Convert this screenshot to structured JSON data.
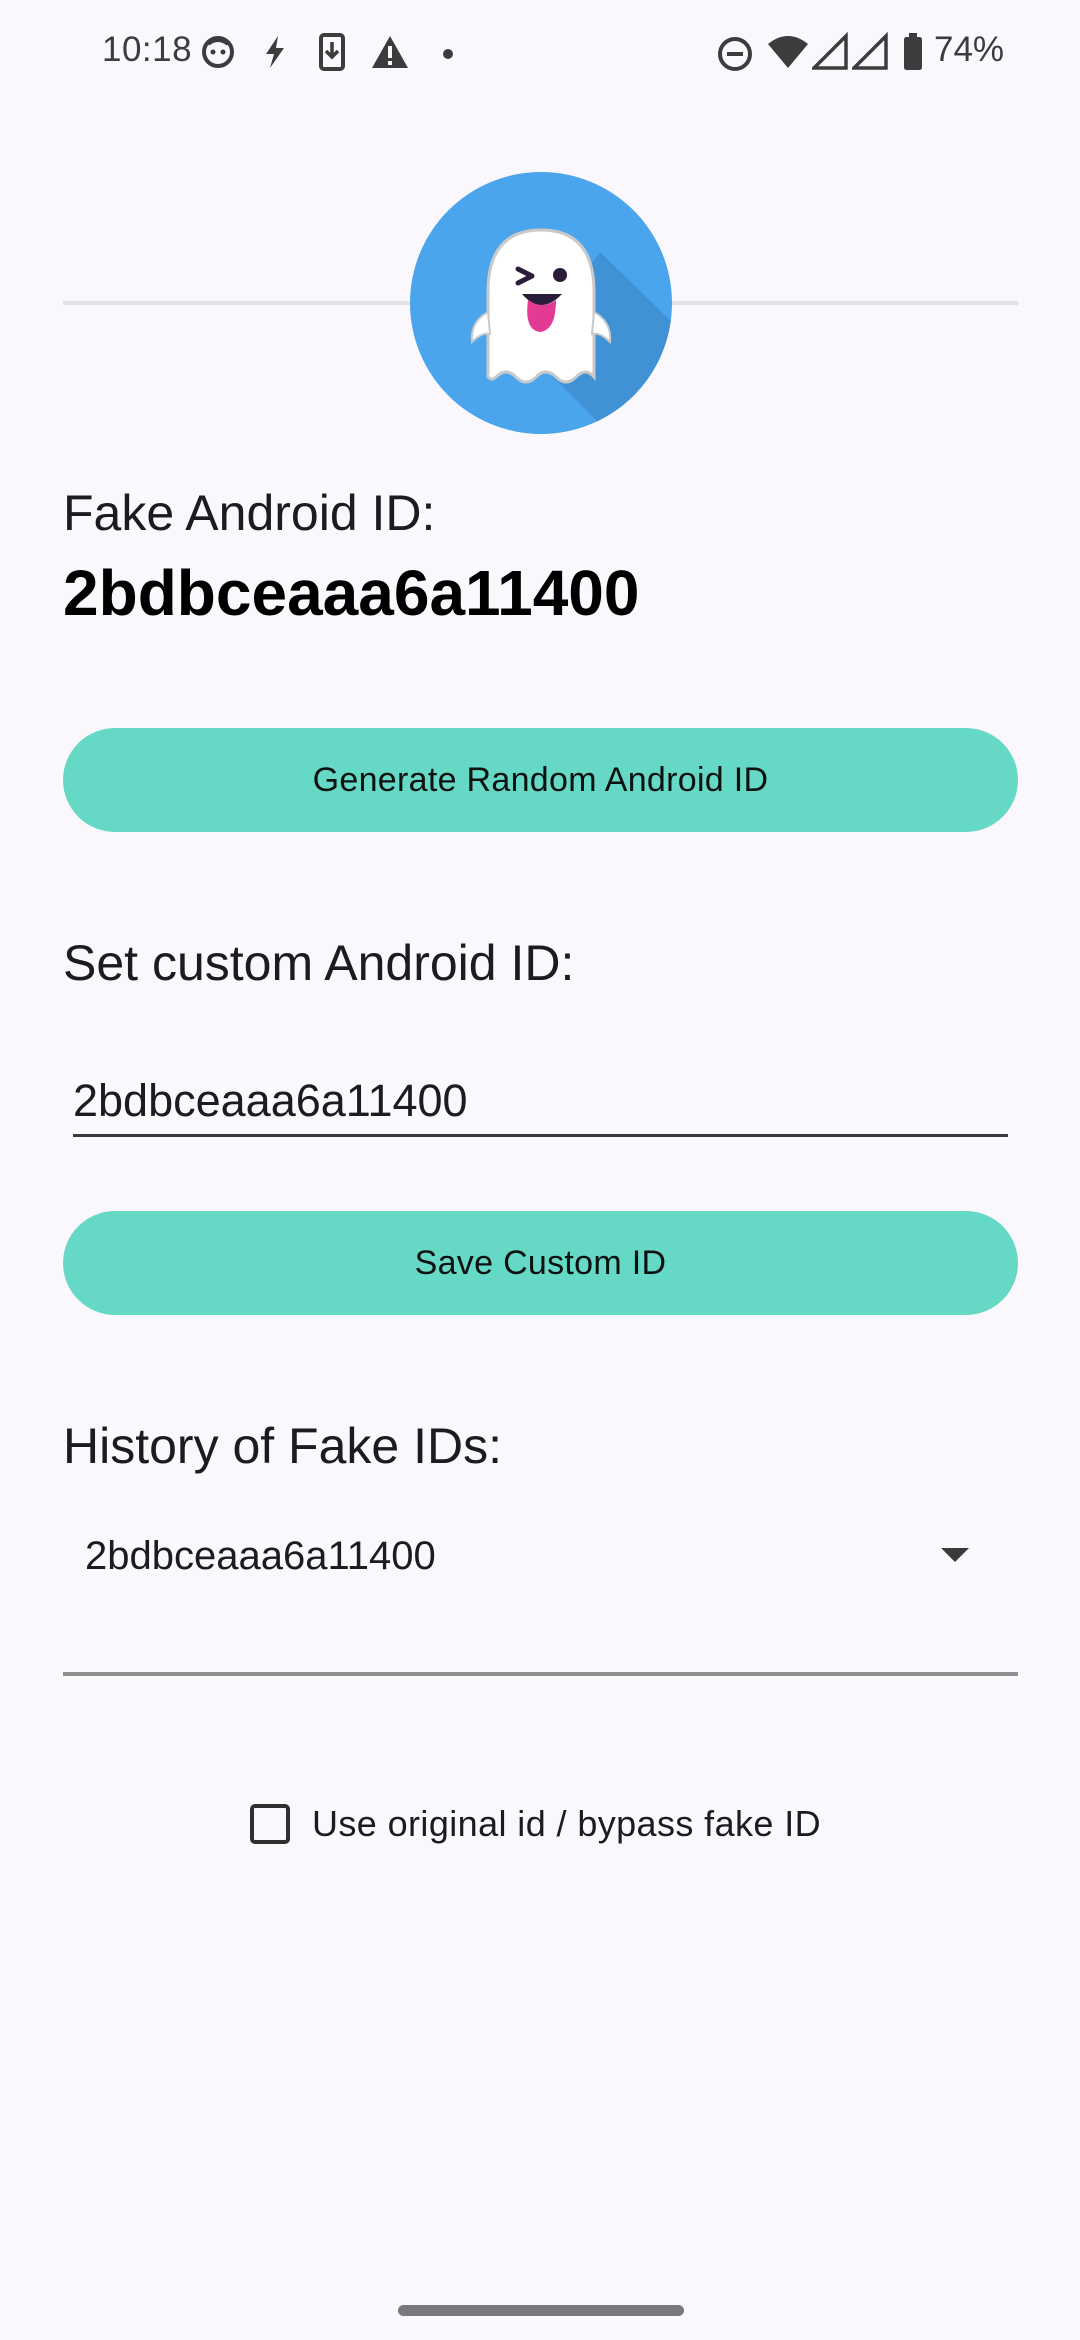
{
  "status_bar": {
    "time": "10:18",
    "battery_percent": "74%",
    "left_icons": [
      "face-icon",
      "bolt-icon",
      "download-icon",
      "warning-icon",
      "dot-icon"
    ],
    "right_icons": [
      "dnd-icon",
      "wifi-icon",
      "signal-icon",
      "signal-icon",
      "battery-icon"
    ]
  },
  "header": {
    "logo_icon": "ghost-icon",
    "logo_color": "#4aa5ec"
  },
  "fake_id": {
    "label": "Fake Android ID:",
    "value": "2bdbceaaa6a11400"
  },
  "generate_button": {
    "label": "Generate Random Android ID"
  },
  "custom_id": {
    "label": "Set custom Android ID:",
    "input_value": "2bdbceaaa6a11400",
    "save_label": "Save Custom ID"
  },
  "history": {
    "label": "History of Fake IDs:",
    "selected": "2bdbceaaa6a11400"
  },
  "bypass": {
    "label": "Use original id / bypass fake ID",
    "checked": false
  },
  "colors": {
    "accent": "#65d8c6",
    "background": "#fbf8fd"
  }
}
